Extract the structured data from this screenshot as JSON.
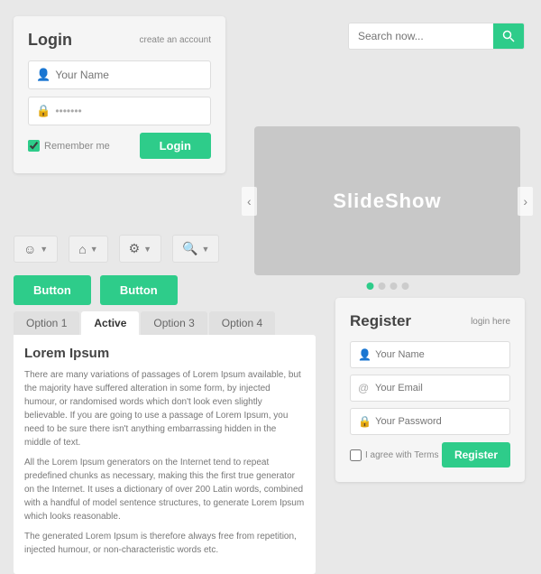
{
  "login": {
    "title": "Login",
    "create_account": "create an account",
    "name_placeholder": "Your Name",
    "password_placeholder": "●●●●●●●",
    "remember_label": "Remember me",
    "login_button": "Login"
  },
  "search": {
    "placeholder": "Search now..."
  },
  "slideshow": {
    "label": "SlideShow",
    "dots": [
      true,
      false,
      false,
      false
    ]
  },
  "toolbar": {
    "items": [
      {
        "icon": "👤",
        "label": "user-icon"
      },
      {
        "icon": "🏠",
        "label": "home-icon"
      },
      {
        "icon": "⚙",
        "label": "gear-icon"
      },
      {
        "icon": "🔍",
        "label": "search-icon"
      }
    ]
  },
  "buttons": {
    "btn1": "Button",
    "btn2": "Button"
  },
  "tabs": {
    "items": [
      "Option 1",
      "Active",
      "Option 3",
      "Option 4"
    ],
    "active_index": 1,
    "content_title": "Lorem Ipsum",
    "content_p1": "There are many variations of passages of Lorem Ipsum available, but the majority have suffered alteration in some form, by injected humour, or randomised words which don't look even slightly believable. If you are going to use a passage of Lorem Ipsum, you need to be sure there isn't anything embarrassing hidden in the middle of text.",
    "content_p2": "All the Lorem Ipsum generators on the Internet tend to repeat predefined chunks as necessary, making this the first true generator on the Internet. It uses a dictionary of over 200 Latin words, combined with a handful of model sentence structures, to generate Lorem Ipsum which looks reasonable.",
    "content_p3": "The generated Lorem Ipsum is therefore always free from repetition, injected humour, or non-characteristic words etc."
  },
  "register": {
    "title": "Register",
    "login_here": "login here",
    "name_placeholder": "Your Name",
    "email_placeholder": "Your Email",
    "password_placeholder": "Your Password",
    "agree_label": "I agree with Terms",
    "register_button": "Register"
  }
}
